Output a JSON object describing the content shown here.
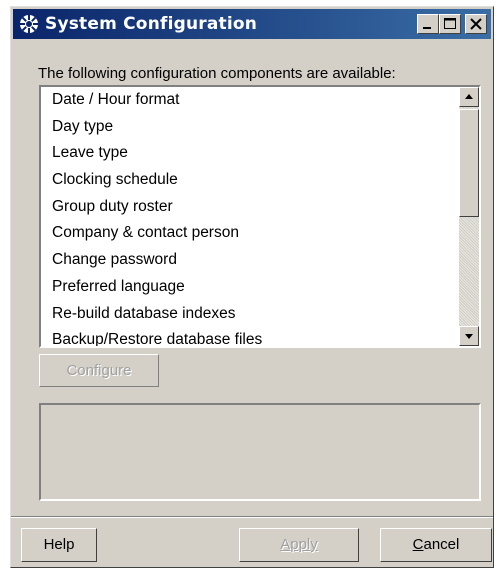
{
  "window": {
    "title": "System Configuration",
    "icon": "gear-icon",
    "titlebar_color": "#0a246a"
  },
  "title_buttons": {
    "minimize": "minimize-icon",
    "maximize": "maximize-icon",
    "close": "close-icon"
  },
  "intro_text": "The following configuration components are available:",
  "components": [
    "Date / Hour format",
    "Day type",
    "Leave type",
    "Clocking schedule",
    "Group duty roster",
    "Company & contact person",
    "Change password",
    "Preferred language",
    "Re-build database indexes",
    "Backup/Restore database files"
  ],
  "configure_label": "Configure",
  "buttons": {
    "help": "Help",
    "apply": "Apply",
    "cancel": "Cancel"
  }
}
